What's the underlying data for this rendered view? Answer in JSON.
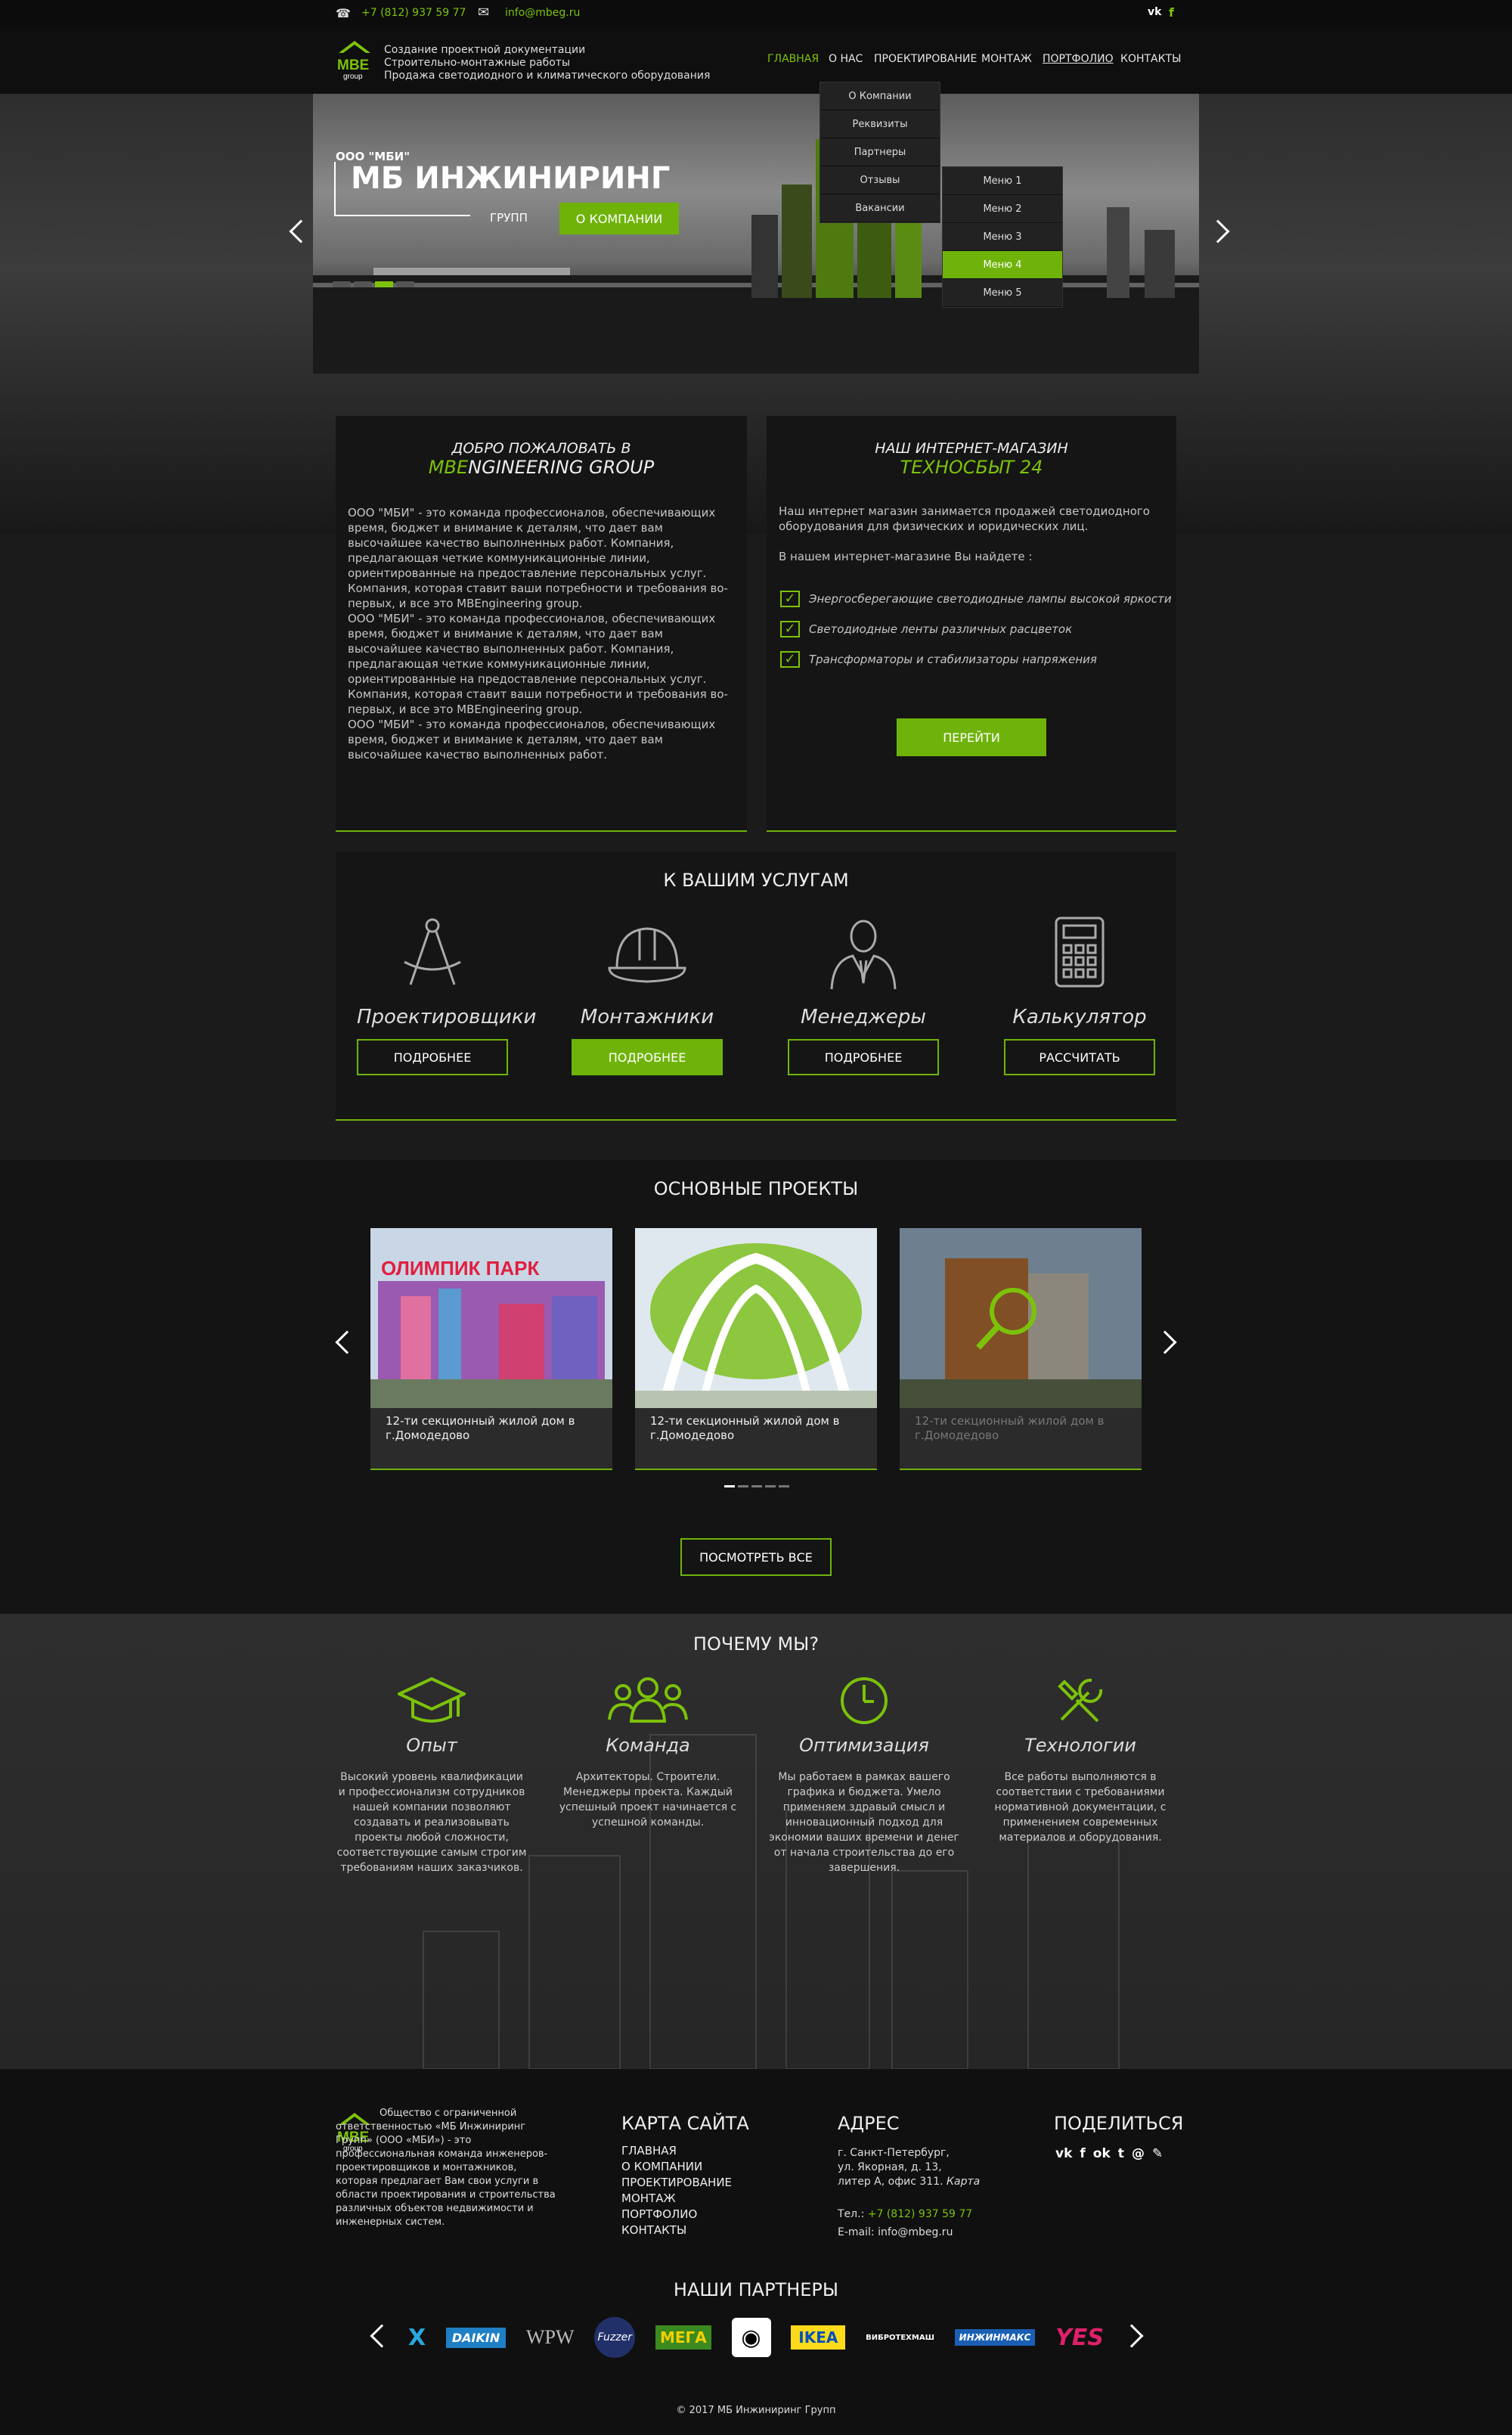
{
  "topbar": {
    "phone": "+7 (812) 937 59 77",
    "email": "info@mbeg.ru",
    "social": [
      "vk",
      "facebook"
    ]
  },
  "header": {
    "logo_text": "MBE",
    "logo_sub": "group",
    "tagline": [
      "Создание проектной документации",
      "Строительно-монтажные работы",
      "Продажа светодиодного и климатического оборудования"
    ],
    "nav": [
      "ГЛАВНАЯ",
      "О НАС",
      "ПРОЕКТИРОВАНИЕ",
      "МОНТАЖ",
      "ПОРТФОЛИО",
      "КОНТАКТЫ"
    ]
  },
  "dropdown": {
    "main": [
      "О Компании",
      "Реквизиты",
      "Партнеры",
      "Отзывы",
      "Вакансии"
    ],
    "sub": [
      "Меню 1",
      "Меню 2",
      "Меню 3",
      "Меню 4",
      "Меню 5"
    ]
  },
  "hero": {
    "company_small": "ООО \"МБИ\"",
    "company_big": "МБ ИНЖИНИРИНГ",
    "group": "ГРУПП",
    "button": "О КОМПАНИИ"
  },
  "welcome": {
    "title_line1": "ДОБРО ПОЖАЛОВАТЬ В",
    "title_green": "MBE",
    "title_rest": "NGINEERING GROUP",
    "p1": "ООО \"МБИ\" - это команда профессионалов, обеспечивающих время, бюджет и внимание к деталям, что дает вам высочайшее качество выполненных работ. Компания, предлагающая четкие коммуникационные линии, ориентированные на предоставление персональных услуг. Компания, которая ставит ваши потребности и требования во-первых, и все это MBEngineering group.",
    "p2": "ООО \"МБИ\" - это команда профессионалов, обеспечивающих время, бюджет и внимание к деталям, что дает вам высочайшее качество выполненных работ. Компания, предлагающая четкие коммуникационные линии, ориентированные на предоставление персональных услуг. Компания, которая ставит ваши потребности и требования во-первых, и все это MBEngineering group.",
    "p3": "ООО \"МБИ\" - это команда профессионалов, обеспечивающих время, бюджет и внимание к деталям, что дает вам высочайшее качество выполненных работ."
  },
  "shop": {
    "title_line1": "НАШ ИНТЕРНЕТ-МАГАЗИН",
    "title_green": "ТЕХНОСБЫТ 24",
    "intro": "Наш интернет магазин занимается продажей светодиодного оборудования для физических и юридических лиц.",
    "find": "В нашем интернет-магазине Вы найдете :",
    "items": [
      "Энергосберегающие светодиодные лампы высокой яркости",
      "Светодиодные ленты различных расцветок",
      "Трансформаторы и стабилизаторы напряжения"
    ],
    "button": "ПЕРЕЙТИ"
  },
  "services": {
    "title": "К ВАШИМ УСЛУГАМ",
    "items": [
      {
        "label": "Проектировщики",
        "button": "ПОДРОБНЕЕ",
        "icon": "compass-icon"
      },
      {
        "label": "Монтажники",
        "button": "ПОДРОБНЕЕ",
        "icon": "hardhat-icon"
      },
      {
        "label": "Менеджеры",
        "button": "ПОДРОБНЕЕ",
        "icon": "manager-icon"
      },
      {
        "label": "Калькулятор",
        "button": "РАССЧИТАТЬ",
        "icon": "calculator-icon"
      }
    ]
  },
  "projects": {
    "title": "ОСНОВНЫЕ ПРОЕКТЫ",
    "items": [
      {
        "caption": "12-ти секционный жилой дом в г.Домодедово",
        "sign": "ОЛИМПИК ПАРК"
      },
      {
        "caption": "12-ти секционный жилой дом в г.Домодедово"
      },
      {
        "caption": "12-ти секционный жилой дом в г.Домодедово"
      }
    ],
    "button": "ПОСМОТРЕТЬ ВСЕ"
  },
  "why": {
    "title": "ПОЧЕМУ МЫ?",
    "items": [
      {
        "label": "Опыт",
        "text": "Высокий уровень квалификации и профессионализм сотрудников нашей компании позволяют создавать и реализовывать проекты любой сложности, соответствующие самым строгим требованиям наших заказчиков.",
        "icon": "graduation-cap-icon"
      },
      {
        "label": "Команда",
        "text": "Архитекторы. Строители. Менеджеры проекта. Каждый успешный проект начинается с успешной команды.",
        "icon": "team-icon"
      },
      {
        "label": "Оптимизация",
        "text": "Мы работаем в рамках вашего графика и бюджета. Умело применяем здравый смысл и инновационный подход для экономии ваших времени и денег от начала строительства до его завершения.",
        "icon": "clock-icon"
      },
      {
        "label": "Технологии",
        "text": "Все работы выполняются в соответствии с требованиями нормативной документации, с применением современных материалов и оборудования.",
        "icon": "tools-icon"
      }
    ]
  },
  "footer": {
    "about": "Общество с ограниченной ответственностью «МБ Инжиниринг Групп» (ООО «МБИ») - это профессиональная команда инженеров-проектировщиков и монтажников, которая предлагает Вам свои услуги в области проектирования и строительства различных объектов недвижимости и инженерных систем.",
    "sitemap_title": "КАРТА САЙТА",
    "sitemap": [
      "ГЛАВНАЯ",
      "О КОМПАНИИ",
      "ПРОЕКТИРОВАНИЕ",
      "МОНТАЖ",
      "ПОРТФОЛИО",
      "КОНТАКТЫ"
    ],
    "address_title": "АДРЕС",
    "address": [
      "г. Санкт-Петербург,",
      "ул. Якорная, д. 13,",
      "литер А, офис 311."
    ],
    "map_link": "Карта",
    "tel_label": "Тел.:",
    "tel": "+7 (812) 937 59 77",
    "email_label": "E-mail:",
    "email": "info@mbeg.ru",
    "share_title": "ПОДЕЛИТЬСЯ",
    "partners_title": "НАШИ ПАРТНЕРЫ",
    "partners": [
      "DAIKIN",
      "WPW",
      "Fuzzer",
      "МЕГА",
      "IKEA",
      "ВИБРОТЕХМАШ",
      "ИНЖИНМАКС",
      "YES"
    ],
    "copyright": "© 2017 МБ Инжиниринг Групп"
  }
}
